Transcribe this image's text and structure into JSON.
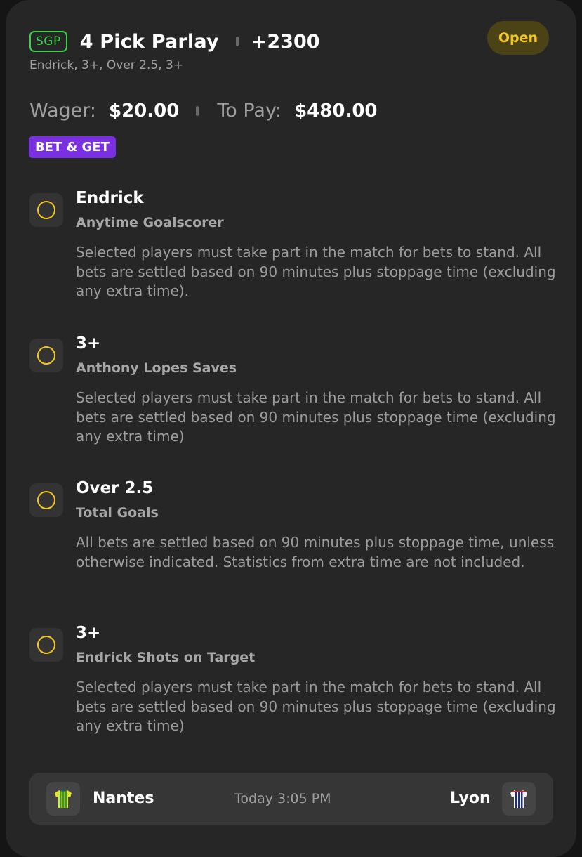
{
  "bet": {
    "badge": "SGP",
    "title": "4 Pick Parlay",
    "odds": "+2300",
    "status": "Open",
    "summary": "Endrick, 3+, Over 2.5, 3+",
    "wager_label": "Wager:",
    "wager_value": "$20.00",
    "payout_label": "To Pay:",
    "payout_value": "$480.00",
    "promo": "BET & GET"
  },
  "legs": [
    {
      "selection": "Endrick",
      "market": "Anytime Goalscorer",
      "rules": "Selected players must take part in the match for bets to stand. All bets are settled based on 90 minutes plus stoppage time (excluding any extra time)."
    },
    {
      "selection": "3+",
      "market": "Anthony Lopes Saves",
      "rules": "Selected players must take part in the match for bets to stand. All bets are settled based on 90 minutes plus stoppage time (excluding any extra time)"
    },
    {
      "selection": "Over 2.5",
      "market": "Total Goals",
      "rules": "All bets are settled based on 90 minutes plus stoppage time, unless otherwise indicated. Statistics from extra time are not included."
    },
    {
      "selection": "3+",
      "market": "Endrick Shots on Target",
      "rules": "Selected players must take part in the match for bets to stand. All bets are settled based on 90 minutes plus stoppage time (excluding any extra time)"
    }
  ],
  "match": {
    "home_team": "Nantes",
    "away_team": "Lyon",
    "kickoff": "Today 3:05 PM",
    "home_jersey_icon": "jersey-yellow-green-stripes-icon",
    "away_jersey_icon": "jersey-white-navy-stripes-icon"
  },
  "colors": {
    "background": "#262626",
    "sgp_green": "#3bd14d",
    "open_yellow": "#f2c623",
    "promo_purple": "#7a2fe0",
    "pending_ring": "#f3c623"
  }
}
